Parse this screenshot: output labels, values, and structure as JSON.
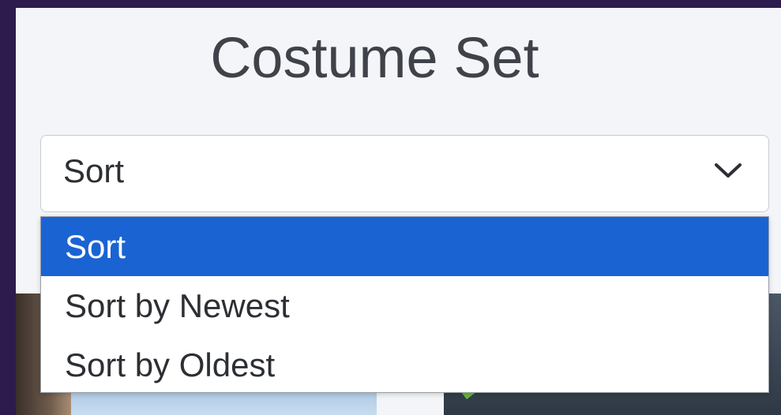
{
  "page": {
    "title": "Costume Set"
  },
  "sort_select": {
    "current_value": "Sort",
    "options": [
      {
        "label": "Sort",
        "selected": true
      },
      {
        "label": "Sort by Newest",
        "selected": false
      },
      {
        "label": "Sort by Oldest",
        "selected": false
      }
    ]
  },
  "icons": {
    "select_arrow": "chevron-down-icon"
  },
  "colors": {
    "outer_background": "#2d1b4e",
    "panel_background": "#f3f5f8",
    "selected_option": "#1a63d3",
    "title_text": "#3f4349"
  }
}
